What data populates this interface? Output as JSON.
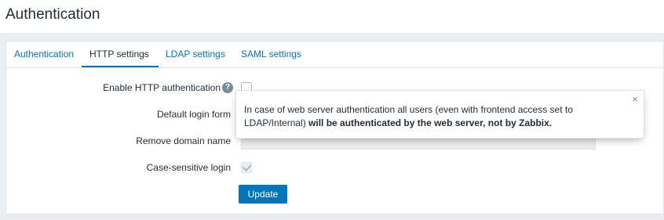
{
  "page": {
    "title": "Authentication"
  },
  "tabs": [
    {
      "label": "Authentication",
      "active": false
    },
    {
      "label": "HTTP settings",
      "active": true
    },
    {
      "label": "LDAP settings",
      "active": false
    },
    {
      "label": "SAML settings",
      "active": false
    }
  ],
  "form": {
    "enable_http_label": "Enable HTTP authentication",
    "help_icon": "question-mark-icon",
    "enable_http_checked": false,
    "default_login_label": "Default login form",
    "remove_domain_label": "Remove domain name",
    "remove_domain_value": "",
    "case_sensitive_label": "Case-sensitive login",
    "case_sensitive_checked": true,
    "update_label": "Update"
  },
  "tooltip": {
    "text_normal": "In case of web server authentication all users (even with frontend access set to LDAP/Internal) ",
    "text_bold": "will be authenticated by the web server, not by Zabbix.",
    "close_icon": "close-icon"
  },
  "colors": {
    "accent": "#0275b8",
    "text": "#1f2c33",
    "background": "#ebeef0",
    "border": "#dfe4e7"
  }
}
